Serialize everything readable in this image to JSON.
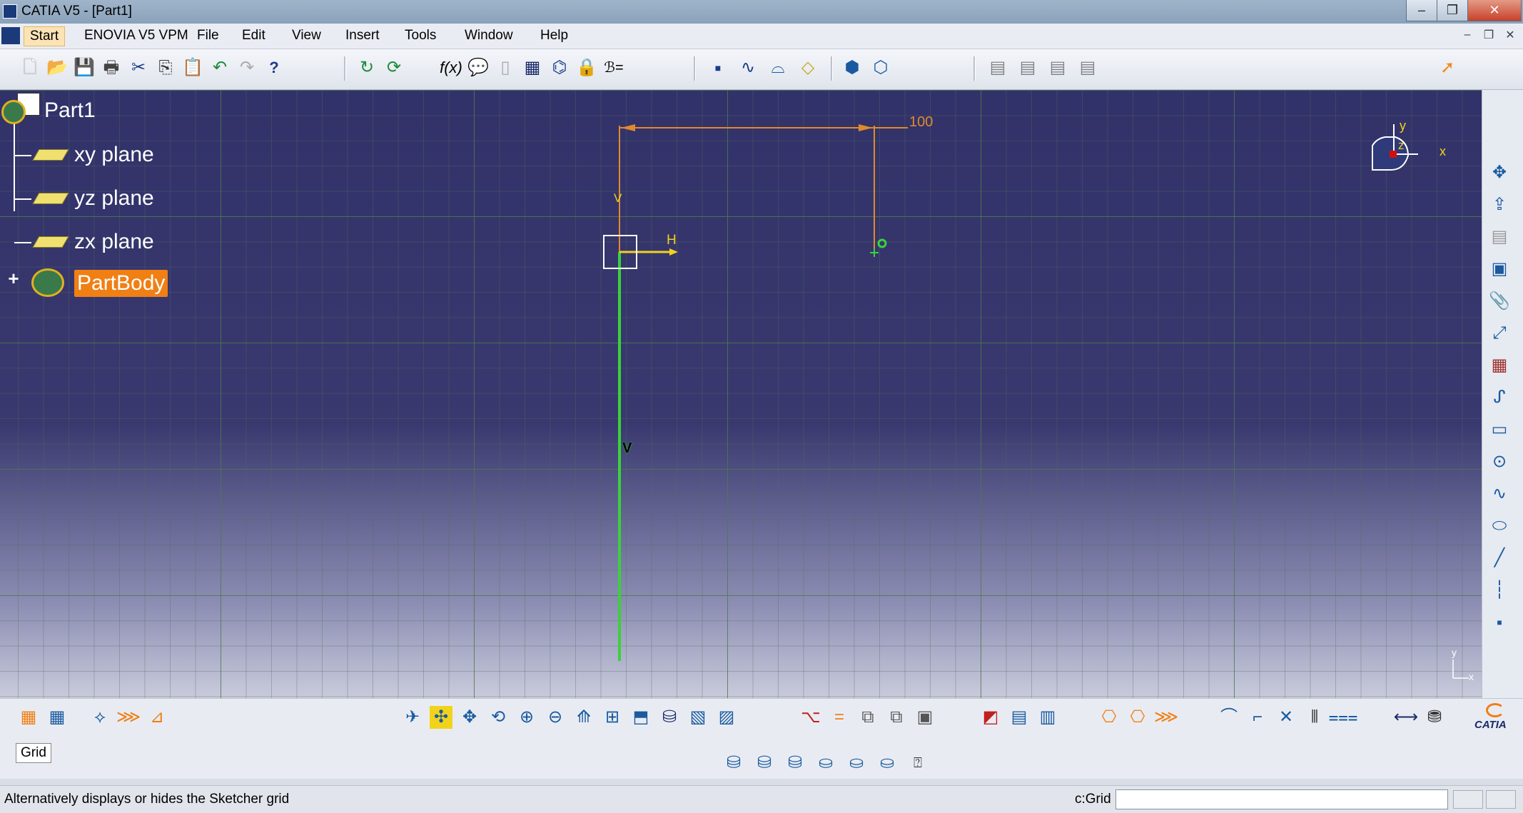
{
  "window": {
    "title": "CATIA V5 - [Part1]",
    "controls": [
      "–",
      "❐",
      "✕"
    ],
    "mdi_controls": [
      "–",
      "❐",
      "✕"
    ]
  },
  "menu": {
    "items": [
      "Start",
      "ENOVIA V5 VPM",
      "File",
      "Edit",
      "View",
      "Insert",
      "Tools",
      "Window",
      "Help"
    ]
  },
  "tree": {
    "root": "Part1",
    "planes": [
      "xy plane",
      "yz plane",
      "zx plane"
    ],
    "body": "PartBody",
    "expand_symbol": "+"
  },
  "sketch": {
    "dimension_value": "100",
    "h_label": "H",
    "v_label": "V",
    "v_small": "V",
    "compass": {
      "y": "y",
      "z": "z",
      "x": "x"
    },
    "corner_axes": {
      "y": "y",
      "x": "x"
    }
  },
  "colors": {
    "background_top": "#32326a",
    "axis_green": "#37d33a",
    "dimension_orange": "#e08a2c",
    "h_axis_yellow": "#f2d21b",
    "selection_orange": "#f07f14"
  },
  "tooltip": {
    "text": "Grid"
  },
  "status": {
    "message": "Alternatively displays or hides the Sketcher grid",
    "command_label": "c:Grid",
    "command_value": ""
  },
  "brand": {
    "logo_text": "CATIA"
  }
}
